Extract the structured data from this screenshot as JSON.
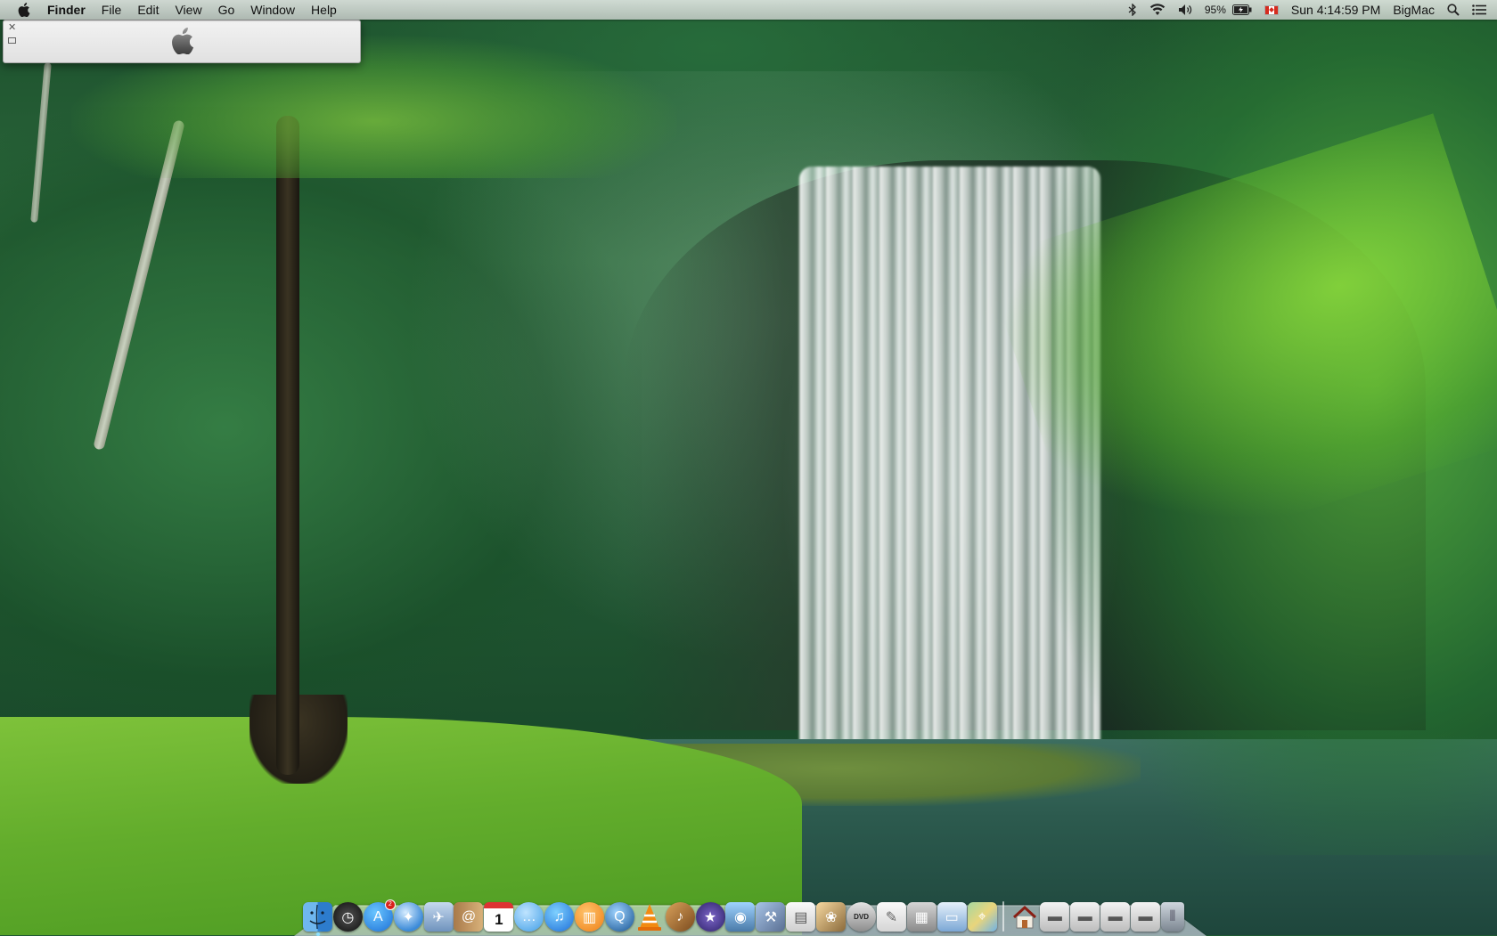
{
  "menubar": {
    "app_name": "Finder",
    "menus": [
      "File",
      "Edit",
      "View",
      "Go",
      "Window",
      "Help"
    ],
    "battery_percent": "95%",
    "clock": "Sun 4:14:59 PM",
    "user_name": "BigMac",
    "status_icons": [
      "bluetooth-icon",
      "wifi-icon",
      "volume-icon",
      "battery-icon",
      "input-source-flag-icon",
      "spotlight-icon",
      "notification-center-icon"
    ]
  },
  "panel": {
    "logo": "apple-logo"
  },
  "dock": {
    "apps": [
      {
        "name": "finder",
        "icon": "finder-icon",
        "running": true
      },
      {
        "name": "dashboard",
        "icon": "dashboard-icon"
      },
      {
        "name": "app-store",
        "icon": "app-store-icon",
        "badge": "2"
      },
      {
        "name": "safari",
        "icon": "safari-icon"
      },
      {
        "name": "mail",
        "icon": "mail-icon"
      },
      {
        "name": "contacts",
        "icon": "contacts-icon"
      },
      {
        "name": "calendar",
        "icon": "calendar-icon",
        "day": "1"
      },
      {
        "name": "messages",
        "icon": "messages-icon"
      },
      {
        "name": "itunes",
        "icon": "itunes-icon"
      },
      {
        "name": "ibooks",
        "icon": "ibooks-icon"
      },
      {
        "name": "quicktime",
        "icon": "quicktime-icon"
      },
      {
        "name": "vlc",
        "icon": "vlc-icon"
      },
      {
        "name": "garageband",
        "icon": "garageband-icon"
      },
      {
        "name": "imovie",
        "icon": "imovie-icon"
      },
      {
        "name": "photo-booth",
        "icon": "photo-booth-icon"
      },
      {
        "name": "xcode",
        "icon": "xcode-icon"
      },
      {
        "name": "preview",
        "icon": "preview-icon"
      },
      {
        "name": "iphoto",
        "icon": "iphoto-icon"
      },
      {
        "name": "dvd-player",
        "icon": "dvd-player-icon",
        "label": "DVD"
      },
      {
        "name": "script-editor",
        "icon": "script-editor-icon"
      },
      {
        "name": "calculator",
        "icon": "calculator-icon"
      },
      {
        "name": "system-information",
        "icon": "system-information-icon"
      },
      {
        "name": "maps",
        "icon": "maps-icon"
      }
    ],
    "stacks": [
      {
        "name": "home-folder",
        "icon": "home-icon"
      },
      {
        "name": "downloads-stack",
        "icon": "stack-icon"
      },
      {
        "name": "documents-stack",
        "icon": "stack-icon"
      },
      {
        "name": "applications-stack",
        "icon": "stack-icon"
      },
      {
        "name": "recent-stack",
        "icon": "stack-icon"
      },
      {
        "name": "trash",
        "icon": "trash-icon"
      }
    ]
  }
}
